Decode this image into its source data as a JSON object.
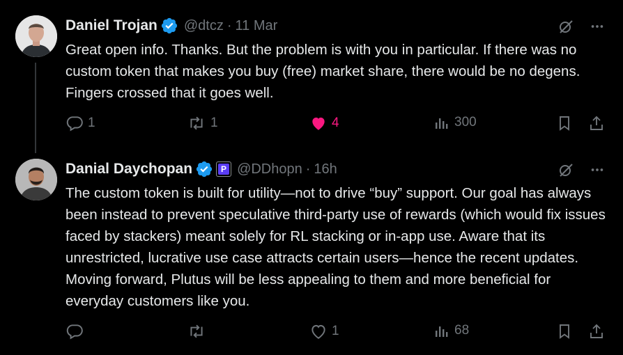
{
  "tweets": [
    {
      "name": "Daniel Trojan",
      "handle": "@dtcz",
      "separator": "·",
      "time": "11 Mar",
      "text": "Great open info. Thanks. But the problem is with you in particular. If there was no custom token that makes you buy (free) market share, there would be no degens. Fingers crossed that it goes well.",
      "replies": "1",
      "retweets": "1",
      "likes": "4",
      "views": "300"
    },
    {
      "name": "Danial Daychopan",
      "affiliate_badge": "P",
      "handle": "@DDhopn",
      "separator": "·",
      "time": "16h",
      "text": "The custom token is built for utility—not to drive “buy” support. Our goal has always been instead to prevent speculative third-party use of rewards (which would fix issues faced by stackers) meant solely for RL stacking or in-app use. Aware that its unrestricted, lucrative use case attracts certain users—hence the recent updates. Moving forward, Plutus will be less appealing to them and more beneficial for everyday customers like you.",
      "replies": "",
      "retweets": "",
      "likes": "1",
      "views": "68"
    }
  ],
  "colors": {
    "background": "#000000",
    "text": "#e7e9ea",
    "muted": "#71767b",
    "verified": "#1d9bf0",
    "like": "#f91880"
  },
  "icons": [
    "verified-badge-icon",
    "grok-icon",
    "more-icon",
    "reply-icon",
    "retweet-icon",
    "like-icon",
    "views-icon",
    "bookmark-icon",
    "share-icon"
  ]
}
